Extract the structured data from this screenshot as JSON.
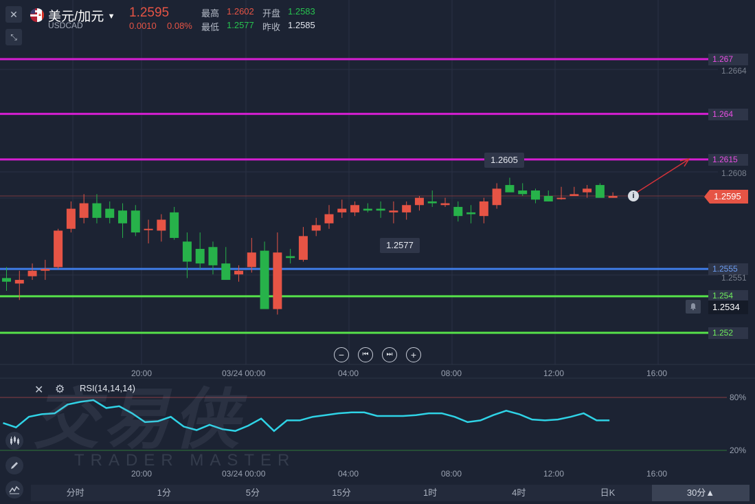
{
  "header": {
    "symbol_name": "美元/加元",
    "symbol_code": "USDCAD",
    "price": "1.2595",
    "change": "0.0010",
    "change_pct": "0.08%",
    "high_label": "最高",
    "high": "1.2602",
    "open_label": "开盘",
    "open": "1.2583",
    "low_label": "最低",
    "low": "1.2577",
    "prev_close_label": "昨收",
    "prev_close": "1.2585"
  },
  "colors": {
    "up": "#e65445",
    "down": "#27b24a",
    "magenta": "#d61ed2",
    "blue": "#3f7de8",
    "green": "#56e24a",
    "rsi": "#2fd3e6",
    "bg": "#1c2333"
  },
  "levels": [
    {
      "value": "1.267",
      "color": "magenta"
    },
    {
      "value": "1.264",
      "color": "magenta"
    },
    {
      "value": "1.2615",
      "color": "magenta"
    },
    {
      "value": "1.2555",
      "color": "blue"
    },
    {
      "value": "1.254",
      "color": "green"
    },
    {
      "value": "1.252",
      "color": "green"
    }
  ],
  "axis_prices": [
    "1.2664",
    "1.2608",
    "1.2551"
  ],
  "current_price_tag": "1.2595",
  "alert_price_tag": "1.2534",
  "callouts": {
    "high": "1.2605",
    "low": "1.2577"
  },
  "x_axis_labels": [
    "20:00",
    "03/24 00:00",
    "04:00",
    "08:00",
    "12:00",
    "16:00"
  ],
  "rsi": {
    "label": "RSI(14,14,14)",
    "upper": "80%",
    "lower": "20%",
    "values": [
      51,
      46,
      58,
      61,
      62,
      72,
      75,
      77,
      68,
      70,
      62,
      52,
      53,
      58,
      47,
      43,
      49,
      44,
      42,
      48,
      56,
      42,
      54,
      54,
      58,
      60,
      62,
      63,
      63,
      59,
      59,
      59,
      60,
      62,
      62,
      58,
      52,
      54,
      60,
      65,
      61,
      55,
      54,
      55,
      58,
      62,
      54,
      54
    ]
  },
  "watermark": {
    "cn": "交易侠",
    "en": "TRADER MASTER"
  },
  "chart_data": {
    "type": "candlestick",
    "title": "USDCAD",
    "ylim": [
      1.2518,
      1.2683
    ],
    "candles": [
      {
        "o": 1.255,
        "h": 1.2556,
        "l": 1.2543,
        "c": 1.2548
      },
      {
        "o": 1.2547,
        "h": 1.2554,
        "l": 1.2538,
        "c": 1.2549
      },
      {
        "o": 1.2551,
        "h": 1.2558,
        "l": 1.2549,
        "c": 1.2554
      },
      {
        "o": 1.2554,
        "h": 1.256,
        "l": 1.2549,
        "c": 1.2555
      },
      {
        "o": 1.2556,
        "h": 1.2577,
        "l": 1.2555,
        "c": 1.2576
      },
      {
        "o": 1.2577,
        "h": 1.2592,
        "l": 1.2575,
        "c": 1.2588
      },
      {
        "o": 1.2583,
        "h": 1.2596,
        "l": 1.258,
        "c": 1.2591
      },
      {
        "o": 1.2591,
        "h": 1.2596,
        "l": 1.258,
        "c": 1.2583
      },
      {
        "o": 1.2588,
        "h": 1.2592,
        "l": 1.258,
        "c": 1.2583
      },
      {
        "o": 1.2587,
        "h": 1.2591,
        "l": 1.2572,
        "c": 1.258
      },
      {
        "o": 1.2587,
        "h": 1.259,
        "l": 1.2573,
        "c": 1.2575
      },
      {
        "o": 1.2577,
        "h": 1.2582,
        "l": 1.2569,
        "c": 1.2577
      },
      {
        "o": 1.2576,
        "h": 1.2585,
        "l": 1.257,
        "c": 1.2582
      },
      {
        "o": 1.2586,
        "h": 1.2589,
        "l": 1.2571,
        "c": 1.2572
      },
      {
        "o": 1.257,
        "h": 1.2575,
        "l": 1.255,
        "c": 1.2559
      },
      {
        "o": 1.2566,
        "h": 1.2575,
        "l": 1.2555,
        "c": 1.2558
      },
      {
        "o": 1.2567,
        "h": 1.257,
        "l": 1.2552,
        "c": 1.2557
      },
      {
        "o": 1.2558,
        "h": 1.2567,
        "l": 1.255,
        "c": 1.2549
      },
      {
        "o": 1.2552,
        "h": 1.2557,
        "l": 1.2548,
        "c": 1.2554
      },
      {
        "o": 1.2556,
        "h": 1.2572,
        "l": 1.2553,
        "c": 1.2564
      },
      {
        "o": 1.2565,
        "h": 1.257,
        "l": 1.2541,
        "c": 1.2533
      },
      {
        "o": 1.2533,
        "h": 1.2575,
        "l": 1.253,
        "c": 1.2564
      },
      {
        "o": 1.2562,
        "h": 1.2566,
        "l": 1.2558,
        "c": 1.2561
      },
      {
        "o": 1.256,
        "h": 1.2578,
        "l": 1.2559,
        "c": 1.2573
      },
      {
        "o": 1.2576,
        "h": 1.2583,
        "l": 1.2573,
        "c": 1.2579
      },
      {
        "o": 1.258,
        "h": 1.259,
        "l": 1.2577,
        "c": 1.2585
      },
      {
        "o": 1.2586,
        "h": 1.2593,
        "l": 1.2583,
        "c": 1.2588
      },
      {
        "o": 1.2586,
        "h": 1.2592,
        "l": 1.2584,
        "c": 1.259
      },
      {
        "o": 1.2588,
        "h": 1.2591,
        "l": 1.2586,
        "c": 1.2587
      },
      {
        "o": 1.2588,
        "h": 1.2592,
        "l": 1.2583,
        "c": 1.2587
      },
      {
        "o": 1.2586,
        "h": 1.2592,
        "l": 1.258,
        "c": 1.2587
      },
      {
        "o": 1.2586,
        "h": 1.2592,
        "l": 1.2582,
        "c": 1.259
      },
      {
        "o": 1.259,
        "h": 1.2595,
        "l": 1.2587,
        "c": 1.2594
      },
      {
        "o": 1.2592,
        "h": 1.2598,
        "l": 1.2589,
        "c": 1.2591
      },
      {
        "o": 1.259,
        "h": 1.2594,
        "l": 1.2589,
        "c": 1.2591
      },
      {
        "o": 1.2589,
        "h": 1.2592,
        "l": 1.2581,
        "c": 1.2584
      },
      {
        "o": 1.2586,
        "h": 1.259,
        "l": 1.258,
        "c": 1.2585
      },
      {
        "o": 1.2584,
        "h": 1.2594,
        "l": 1.258,
        "c": 1.2592
      },
      {
        "o": 1.259,
        "h": 1.2602,
        "l": 1.2588,
        "c": 1.2599
      },
      {
        "o": 1.2601,
        "h": 1.2605,
        "l": 1.2598,
        "c": 1.2597
      },
      {
        "o": 1.2598,
        "h": 1.2602,
        "l": 1.2595,
        "c": 1.2596
      },
      {
        "o": 1.2598,
        "h": 1.2599,
        "l": 1.2591,
        "c": 1.2593
      },
      {
        "o": 1.2595,
        "h": 1.2598,
        "l": 1.2592,
        "c": 1.2592
      },
      {
        "o": 1.2594,
        "h": 1.26,
        "l": 1.2593,
        "c": 1.2594
      },
      {
        "o": 1.2595,
        "h": 1.26,
        "l": 1.2595,
        "c": 1.2596
      },
      {
        "o": 1.2597,
        "h": 1.2601,
        "l": 1.2594,
        "c": 1.2599
      },
      {
        "o": 1.2601,
        "h": 1.2602,
        "l": 1.2595,
        "c": 1.2594
      },
      {
        "o": 1.2594,
        "h": 1.2597,
        "l": 1.2594,
        "c": 1.2595
      }
    ]
  },
  "toolbar": {
    "timeframes": [
      "分时",
      "1分",
      "5分",
      "15分",
      "1时",
      "4时",
      "日K"
    ],
    "selected": "30分▲"
  }
}
